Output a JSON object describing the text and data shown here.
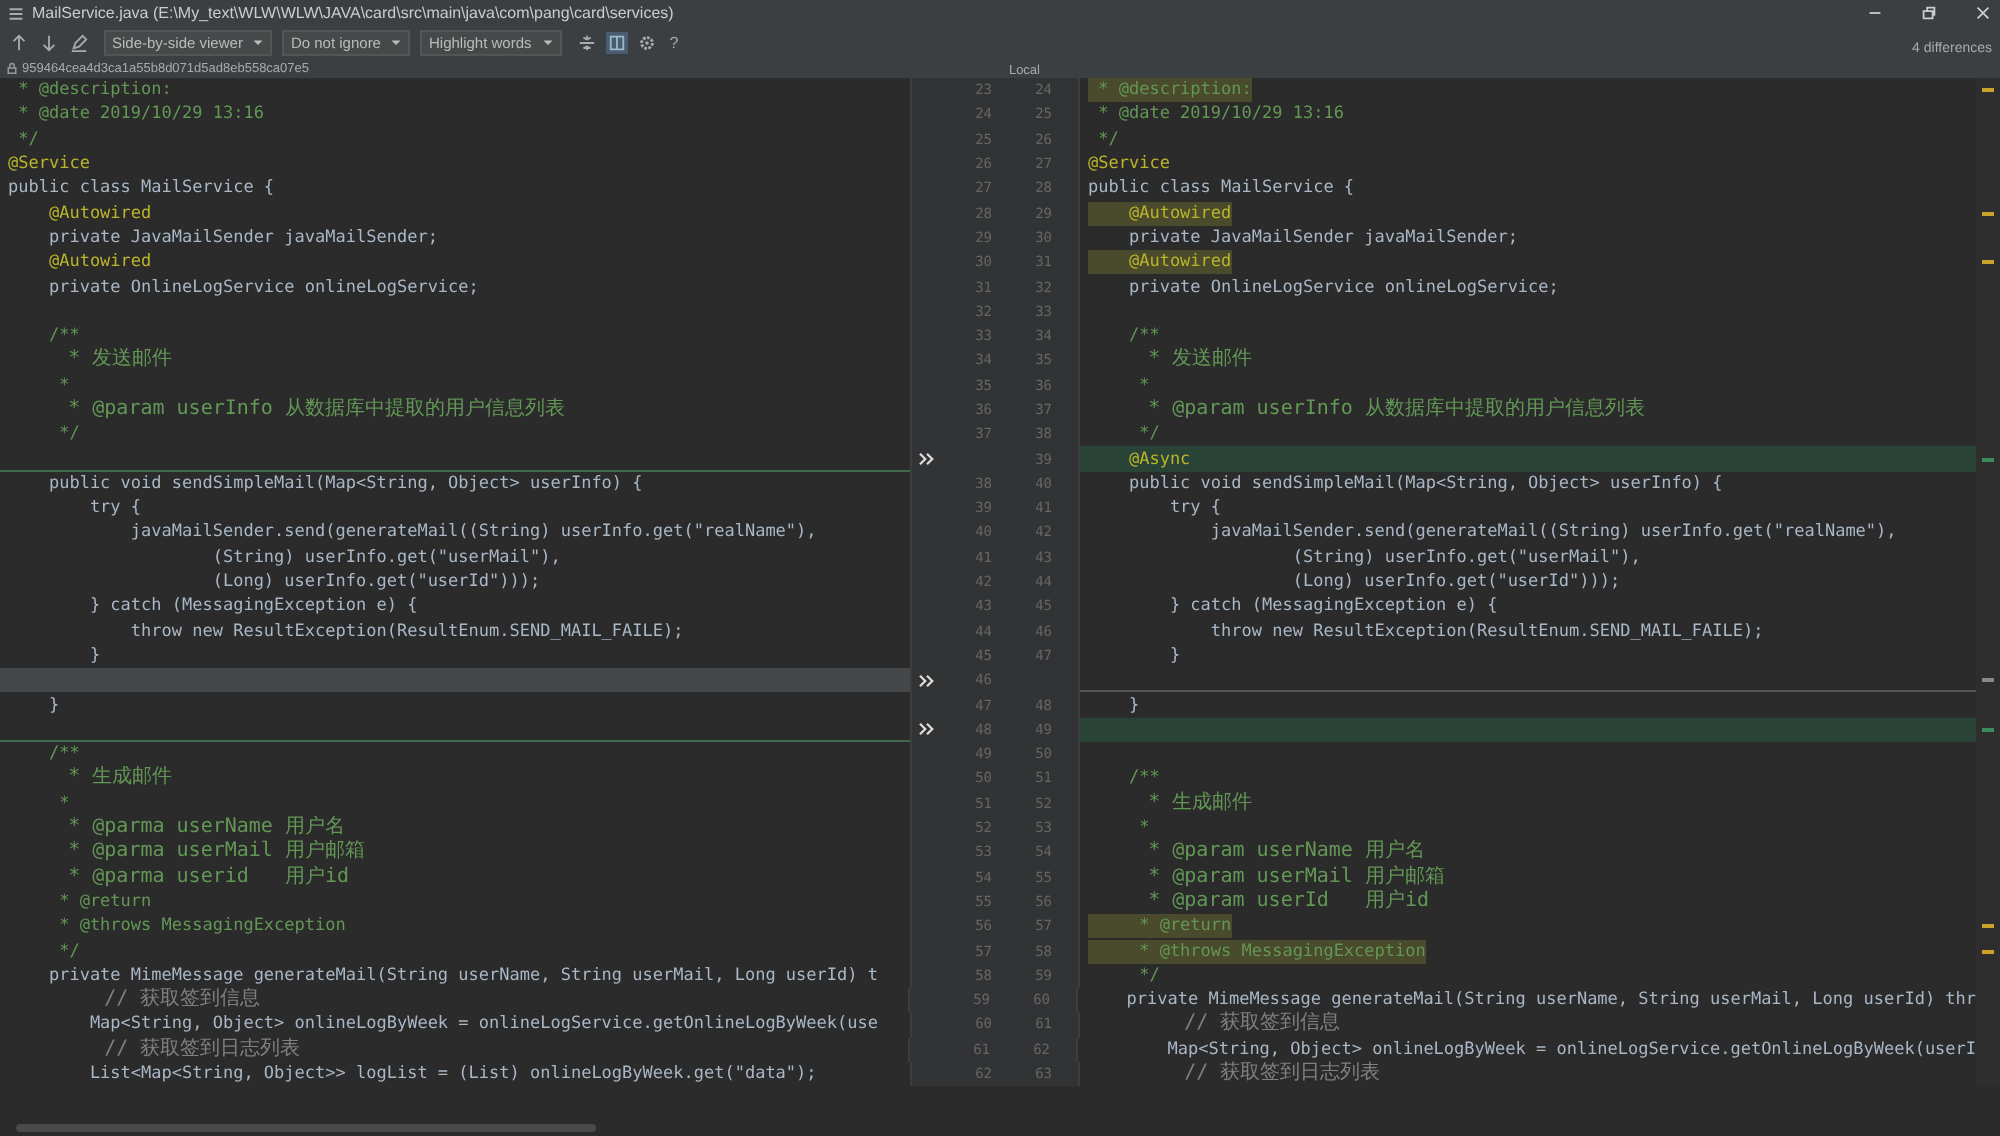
{
  "window": {
    "title": "MailService.java (E:\\My_text\\WLW\\WLW\\JAVA\\card\\src\\main\\java\\com\\pang\\card\\services)"
  },
  "toolbar": {
    "dropdowns": [
      {
        "label": "Side-by-side viewer"
      },
      {
        "label": "Do not ignore"
      },
      {
        "label": "Highlight words"
      }
    ],
    "help": "?"
  },
  "differences": "4 differences",
  "left_header": {
    "revision": "959464cea4d3ca1a55b8d071d5ad8eb558ca07e5"
  },
  "right_header": {
    "label": "Local"
  },
  "rows": [
    {
      "kind": "modified",
      "left": {
        "num": "23",
        "text": " * @description:",
        "kind": "doc"
      },
      "right": {
        "num": "24",
        "text": " * @description:",
        "kind": "doc"
      }
    },
    {
      "kind": "same",
      "left": {
        "num": "24",
        "text": " * @date 2019/10/29 13:16",
        "kind": "doc"
      },
      "right": {
        "num": "25",
        "text": " * @date 2019/10/29 13:16",
        "kind": "doc"
      }
    },
    {
      "kind": "same",
      "left": {
        "num": "25",
        "text": " */",
        "kind": "doc"
      },
      "right": {
        "num": "26",
        "text": " */",
        "kind": "doc"
      }
    },
    {
      "kind": "same",
      "left": {
        "num": "26",
        "text": "@Service",
        "kind": "annotation"
      },
      "right": {
        "num": "27",
        "text": "@Service",
        "kind": "annotation"
      }
    },
    {
      "kind": "same",
      "left": {
        "num": "27",
        "text": "public class MailService {",
        "kind": "code"
      },
      "right": {
        "num": "28",
        "text": "public class MailService {",
        "kind": "code"
      }
    },
    {
      "kind": "modified",
      "left": {
        "num": "28",
        "text": "    @Autowired",
        "kind": "annotation"
      },
      "right": {
        "num": "29",
        "text": "    @Autowired",
        "kind": "annotation"
      }
    },
    {
      "kind": "same",
      "left": {
        "num": "29",
        "text": "    private JavaMailSender javaMailSender;",
        "kind": "code"
      },
      "right": {
        "num": "30",
        "text": "    private JavaMailSender javaMailSender;",
        "kind": "code"
      }
    },
    {
      "kind": "modified",
      "left": {
        "num": "30",
        "text": "    @Autowired",
        "kind": "annotation"
      },
      "right": {
        "num": "31",
        "text": "    @Autowired",
        "kind": "annotation"
      }
    },
    {
      "kind": "same",
      "left": {
        "num": "31",
        "text": "    private OnlineLogService onlineLogService;",
        "kind": "code"
      },
      "right": {
        "num": "32",
        "text": "    private OnlineLogService onlineLogService;",
        "kind": "code"
      }
    },
    {
      "kind": "same",
      "left": {
        "num": "32"
      },
      "right": {
        "num": "33"
      }
    },
    {
      "kind": "same",
      "left": {
        "num": "33",
        "text": "    /**",
        "kind": "doc"
      },
      "right": {
        "num": "34",
        "text": "    /**",
        "kind": "doc"
      }
    },
    {
      "kind": "same",
      "left": {
        "num": "34",
        "text": "     * 发送邮件",
        "kind": "doc"
      },
      "right": {
        "num": "35",
        "text": "     * 发送邮件",
        "kind": "doc"
      }
    },
    {
      "kind": "same",
      "left": {
        "num": "35",
        "text": "     *",
        "kind": "doc"
      },
      "right": {
        "num": "36",
        "text": "     *",
        "kind": "doc"
      }
    },
    {
      "kind": "same",
      "left": {
        "num": "36",
        "text": "     * @param userInfo 从数据库中提取的用户信息列表",
        "kind": "doc"
      },
      "right": {
        "num": "37",
        "text": "     * @param userInfo 从数据库中提取的用户信息列表",
        "kind": "doc"
      }
    },
    {
      "kind": "same",
      "left": {
        "num": "37",
        "text": "     */",
        "kind": "doc"
      },
      "right": {
        "num": "38",
        "text": "     */",
        "kind": "doc"
      }
    },
    {
      "kind": "inserted",
      "right": {
        "num": "39",
        "text": "    @Async",
        "kind": "annotation"
      }
    },
    {
      "kind": "same",
      "left": {
        "num": "38",
        "text": "    public void sendSimpleMail(Map<String, Object> userInfo) {",
        "kind": "code"
      },
      "right": {
        "num": "40",
        "text": "    public void sendSimpleMail(Map<String, Object> userInfo) {",
        "kind": "code"
      }
    },
    {
      "kind": "same",
      "left": {
        "num": "39",
        "text": "        try {",
        "kind": "code"
      },
      "right": {
        "num": "41",
        "text": "        try {",
        "kind": "code"
      }
    },
    {
      "kind": "same",
      "left": {
        "num": "40",
        "text": "            javaMailSender.send(generateMail((String) userInfo.get(\"realName\"),",
        "kind": "code"
      },
      "right": {
        "num": "42",
        "text": "            javaMailSender.send(generateMail((String) userInfo.get(\"realName\"),",
        "kind": "code"
      }
    },
    {
      "kind": "same",
      "left": {
        "num": "41",
        "text": "                    (String) userInfo.get(\"userMail\"),",
        "kind": "code"
      },
      "right": {
        "num": "43",
        "text": "                    (String) userInfo.get(\"userMail\"),",
        "kind": "code"
      }
    },
    {
      "kind": "same",
      "left": {
        "num": "42",
        "text": "                    (Long) userInfo.get(\"userId\")));",
        "kind": "code"
      },
      "right": {
        "num": "44",
        "text": "                    (Long) userInfo.get(\"userId\")));",
        "kind": "code"
      }
    },
    {
      "kind": "same",
      "left": {
        "num": "43",
        "text": "        } catch (MessagingException e) {",
        "kind": "code"
      },
      "right": {
        "num": "45",
        "text": "        } catch (MessagingException e) {",
        "kind": "code"
      }
    },
    {
      "kind": "same",
      "left": {
        "num": "44",
        "text": "            throw new ResultException(ResultEnum.SEND_MAIL_FAILE);",
        "kind": "code"
      },
      "right": {
        "num": "46",
        "text": "            throw new ResultException(ResultEnum.SEND_MAIL_FAILE);",
        "kind": "code"
      }
    },
    {
      "kind": "same",
      "left": {
        "num": "45",
        "text": "        }",
        "kind": "code"
      },
      "right": {
        "num": "47",
        "text": "        }",
        "kind": "code"
      }
    },
    {
      "kind": "deleted",
      "left": {
        "num": "46"
      }
    },
    {
      "kind": "same",
      "left": {
        "num": "47",
        "text": "    }",
        "kind": "code"
      },
      "right": {
        "num": "48",
        "text": "    }",
        "kind": "code"
      }
    },
    {
      "kind": "inserted",
      "left": {
        "num": "48"
      },
      "right": {
        "num": "49"
      }
    },
    {
      "kind": "same",
      "left": {
        "num": "49",
        "text": "    /**",
        "kind": "doc"
      },
      "right": {
        "num": "50"
      }
    },
    {
      "kind": "same",
      "left": {
        "num": "50",
        "text": "     * 生成邮件",
        "kind": "doc"
      },
      "right": {
        "num": "51",
        "text": "    /**",
        "kind": "doc"
      }
    },
    {
      "kind": "same",
      "left": {
        "num": "51",
        "text": "     *",
        "kind": "doc"
      },
      "right": {
        "num": "52",
        "text": "     * 生成邮件",
        "kind": "doc"
      }
    },
    {
      "kind": "same",
      "left": {
        "num": "52",
        "text": "     * @parma userName 用户名",
        "kind": "doc"
      },
      "right": {
        "num": "53",
        "text": "     *",
        "kind": "doc"
      }
    },
    {
      "kind": "same",
      "left": {
        "num": "53",
        "text": "     * @parma userMail 用户邮箱",
        "kind": "doc"
      },
      "right": {
        "num": "54",
        "text": "     * @param userName 用户名",
        "kind": "doc"
      }
    },
    {
      "kind": "same",
      "left": {
        "num": "54",
        "text": "     * @parma userid   用户id",
        "kind": "doc"
      },
      "right": {
        "num": "55",
        "text": "     * @param userMail 用户邮箱",
        "kind": "doc"
      }
    },
    {
      "kind": "same",
      "left": {
        "num": "55",
        "text": "     * @return",
        "kind": "doc"
      },
      "right": {
        "num": "56",
        "text": "     * @param userId   用户id",
        "kind": "doc"
      }
    },
    {
      "kind": "modified",
      "left": {
        "num": "56",
        "text": "     * @throws MessagingException",
        "kind": "doc"
      },
      "right": {
        "num": "57",
        "text": "     * @return",
        "kind": "doc"
      }
    },
    {
      "kind": "modified",
      "left": {
        "num": "57",
        "text": "     */",
        "kind": "doc"
      },
      "right": {
        "num": "58",
        "text": "     * @throws MessagingException",
        "kind": "doc"
      }
    },
    {
      "kind": "same",
      "left": {
        "num": "58",
        "text": "    private MimeMessage generateMail(String userName, String userMail, Long userId) t",
        "kind": "code"
      },
      "right": {
        "num": "59",
        "text": "     */",
        "kind": "doc"
      }
    },
    {
      "kind": "same",
      "left": {
        "num": "59",
        "text": "        // 获取签到信息",
        "kind": "comment"
      },
      "right": {
        "num": "60",
        "text": "    private MimeMessage generateMail(String userName, String userMail, Long userId) thr",
        "kind": "code"
      }
    },
    {
      "kind": "same",
      "left": {
        "num": "60",
        "text": "        Map<String, Object> onlineLogByWeek = onlineLogService.getOnlineLogByWeek(use",
        "kind": "code"
      },
      "right": {
        "num": "61",
        "text": "        // 获取签到信息",
        "kind": "comment"
      }
    },
    {
      "kind": "same",
      "left": {
        "num": "61",
        "text": "        // 获取签到日志列表",
        "kind": "comment"
      },
      "right": {
        "num": "62",
        "text": "        Map<String, Object> onlineLogByWeek = onlineLogService.getOnlineLogByWeek(userI",
        "kind": "code"
      }
    },
    {
      "kind": "same",
      "left": {
        "num": "62",
        "text": "        List<Map<String, Object>> logList = (List) onlineLogByWeek.get(\"data\");",
        "kind": "code"
      },
      "right": {
        "num": "63",
        "text": "        // 获取签到日志列表",
        "kind": "comment"
      }
    }
  ]
}
